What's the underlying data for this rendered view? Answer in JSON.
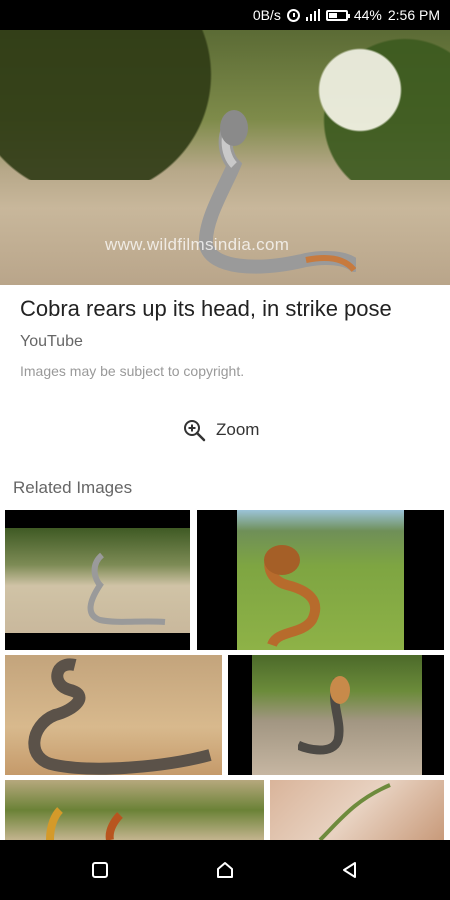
{
  "status_bar": {
    "net_speed": "0B/s",
    "battery_percent": "44%",
    "time": "2:56 PM",
    "icons": [
      "alarm-icon",
      "signal-icon",
      "battery-icon"
    ]
  },
  "hero_image": {
    "watermark": "www.wildfilmsindia.com"
  },
  "result": {
    "title": "Cobra rears up its head, in strike pose",
    "source": "YouTube",
    "copyright": "Images may be subject to copyright."
  },
  "zoom": {
    "label": "Zoom",
    "icon": "zoom-in-icon"
  },
  "related": {
    "heading": "Related Images"
  },
  "nav_bar": {
    "icons": [
      "recent-apps-icon",
      "home-icon",
      "back-icon"
    ]
  },
  "colors": {
    "status_bg": "#000000",
    "nav_bg": "#000000",
    "title_text": "#222222",
    "muted_text": "#666666"
  }
}
